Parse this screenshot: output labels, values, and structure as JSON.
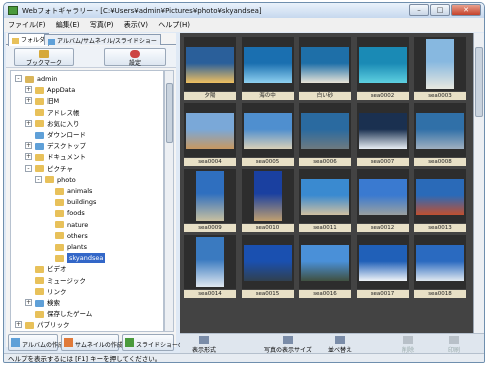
{
  "title": "Webフォトギャラリー - [C:¥Users¥admin¥Pictures¥photo¥skyandsea]",
  "window_controls": {
    "minimize": "–",
    "maximize": "□",
    "close": "✕"
  },
  "menu": [
    "ファイル(F)",
    "編集(E)",
    "写真(P)",
    "表示(V)",
    "ヘルプ(H)"
  ],
  "left_tabs": [
    "フォルダ",
    "アルバム/サムネイル/スライドショー"
  ],
  "left_buttons": {
    "bookmark": "ブックマーク",
    "settings": "設定"
  },
  "tree": [
    {
      "label": "admin",
      "indent": 0,
      "exp": "-",
      "icon": "user",
      "color": "#d9b55a"
    },
    {
      "label": "AppData",
      "indent": 1,
      "exp": "+",
      "icon": "folder",
      "color": "#e8c15a"
    },
    {
      "label": "旧M",
      "indent": 1,
      "exp": "+",
      "icon": "folder",
      "color": "#e8c15a"
    },
    {
      "label": "アドレス帳",
      "indent": 1,
      "exp": "",
      "icon": "folder",
      "color": "#e8c15a"
    },
    {
      "label": "お気に入り",
      "indent": 1,
      "exp": "+",
      "icon": "folder",
      "color": "#e8c15a"
    },
    {
      "label": "ダウンロード",
      "indent": 1,
      "exp": "",
      "icon": "folder",
      "color": "#5fa0d8"
    },
    {
      "label": "デスクトップ",
      "indent": 1,
      "exp": "+",
      "icon": "folder",
      "color": "#5fa0d8"
    },
    {
      "label": "ドキュメント",
      "indent": 1,
      "exp": "+",
      "icon": "folder",
      "color": "#e8c15a"
    },
    {
      "label": "ピクチャ",
      "indent": 1,
      "exp": "-",
      "icon": "folder",
      "color": "#e8c15a"
    },
    {
      "label": "photo",
      "indent": 2,
      "exp": "-",
      "icon": "folder",
      "color": "#e8c15a"
    },
    {
      "label": "animals",
      "indent": 3,
      "exp": "",
      "icon": "folder",
      "color": "#e8c15a"
    },
    {
      "label": "buildings",
      "indent": 3,
      "exp": "",
      "icon": "folder",
      "color": "#e8c15a"
    },
    {
      "label": "foods",
      "indent": 3,
      "exp": "",
      "icon": "folder",
      "color": "#e8c15a"
    },
    {
      "label": "nature",
      "indent": 3,
      "exp": "",
      "icon": "folder",
      "color": "#e8c15a"
    },
    {
      "label": "others",
      "indent": 3,
      "exp": "",
      "icon": "folder",
      "color": "#e8c15a"
    },
    {
      "label": "plants",
      "indent": 3,
      "exp": "",
      "icon": "folder",
      "color": "#e8c15a"
    },
    {
      "label": "skyandsea",
      "indent": 3,
      "exp": "",
      "icon": "folder",
      "color": "#e8c15a",
      "selected": true
    },
    {
      "label": "ビデオ",
      "indent": 1,
      "exp": "",
      "icon": "folder",
      "color": "#e8c15a"
    },
    {
      "label": "ミュージック",
      "indent": 1,
      "exp": "",
      "icon": "folder",
      "color": "#e8c15a"
    },
    {
      "label": "リンク",
      "indent": 1,
      "exp": "",
      "icon": "folder",
      "color": "#e8c15a"
    },
    {
      "label": "検索",
      "indent": 1,
      "exp": "+",
      "icon": "folder",
      "color": "#5fa0d8"
    },
    {
      "label": "保存したゲーム",
      "indent": 1,
      "exp": "",
      "icon": "folder",
      "color": "#e8c15a"
    },
    {
      "label": "パブリック",
      "indent": 0,
      "exp": "+",
      "icon": "folder",
      "color": "#e8c15a"
    }
  ],
  "left_bottom_buttons": [
    "アルバムの作成",
    "サムネイルの作成",
    "スライドショーの作成"
  ],
  "thumbnails": [
    {
      "caption": "夕陽",
      "palette": [
        "#2a5f9a",
        "#f0c060"
      ]
    },
    {
      "caption": "海の中",
      "palette": [
        "#1a6fb0",
        "#8fd0f0"
      ]
    },
    {
      "caption": "白い砂",
      "palette": [
        "#1e6fa8",
        "#e8e4d8"
      ]
    },
    {
      "caption": "sea0002",
      "palette": [
        "#1a8ab5",
        "#5ed0e0"
      ]
    },
    {
      "caption": "sea0003",
      "palette": [
        "#87b8e0",
        "#e8e8e0"
      ]
    },
    {
      "caption": "sea0004",
      "palette": [
        "#7aa8d8",
        "#c89860"
      ]
    },
    {
      "caption": "sea0005",
      "palette": [
        "#4f8fcf",
        "#d9d0b8"
      ]
    },
    {
      "caption": "sea0006",
      "palette": [
        "#2a6aa0",
        "#6e7a80"
      ]
    },
    {
      "caption": "sea0007",
      "palette": [
        "#1a3050",
        "#e8eef4"
      ]
    },
    {
      "caption": "sea0008",
      "palette": [
        "#3070a8",
        "#a0b0c0"
      ]
    },
    {
      "caption": "sea0009",
      "palette": [
        "#2f6fbf",
        "#c8c0a0"
      ]
    },
    {
      "caption": "sea0010",
      "palette": [
        "#1a40a0",
        "#c0a070"
      ]
    },
    {
      "caption": "sea0011",
      "palette": [
        "#3a8ad0",
        "#d0c0a0"
      ]
    },
    {
      "caption": "sea0012",
      "palette": [
        "#3a7ad0",
        "#9aa0a0"
      ]
    },
    {
      "caption": "sea0013",
      "palette": [
        "#2a6ab8",
        "#c05030"
      ]
    },
    {
      "caption": "sea0014",
      "palette": [
        "#3a7ac0",
        "#e0e8f0"
      ]
    },
    {
      "caption": "sea0015",
      "palette": [
        "#1a50b0",
        "#304050"
      ]
    },
    {
      "caption": "sea0016",
      "palette": [
        "#4a90d8",
        "#405040"
      ]
    },
    {
      "caption": "sea0017",
      "palette": [
        "#2060b8",
        "#f0f4f8"
      ]
    },
    {
      "caption": "sea0018",
      "palette": [
        "#2a6ac0",
        "#e0e8f0"
      ]
    }
  ],
  "bottom_toolbar": [
    "表示形式",
    "写真の表示サイズ",
    "並べ替え",
    "削除",
    "印刷"
  ],
  "status": "ヘルプを表示するには [F1] キーを押してください。"
}
